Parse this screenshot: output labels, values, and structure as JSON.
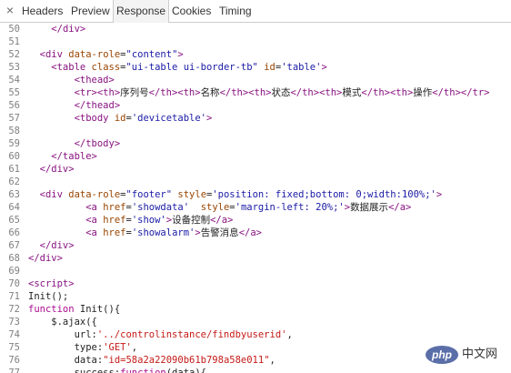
{
  "toolbar": {
    "close_glyph": "×",
    "tabs": [
      {
        "label": "Headers"
      },
      {
        "label": "Preview"
      },
      {
        "label": "Response"
      },
      {
        "label": "Cookies"
      },
      {
        "label": "Timing"
      }
    ],
    "active_tab": "Response"
  },
  "code": {
    "lines": [
      {
        "n": "50",
        "tokens": [
          {
            "t": "    </",
            "c": "tag"
          },
          {
            "t": "div",
            "c": "tag"
          },
          {
            "t": ">",
            "c": "tag"
          }
        ]
      },
      {
        "n": "51",
        "tokens": []
      },
      {
        "n": "52",
        "tokens": [
          {
            "t": "  <div ",
            "c": "tag"
          },
          {
            "t": "data-role",
            "c": "attr"
          },
          {
            "t": "=",
            "c": "plain"
          },
          {
            "t": "\"content\"",
            "c": "val"
          },
          {
            "t": ">",
            "c": "tag"
          }
        ]
      },
      {
        "n": "53",
        "tokens": [
          {
            "t": "    <table ",
            "c": "tag"
          },
          {
            "t": "class",
            "c": "attr"
          },
          {
            "t": "=",
            "c": "plain"
          },
          {
            "t": "\"ui-table ui-border-tb\"",
            "c": "val"
          },
          {
            "t": " ",
            "c": "plain"
          },
          {
            "t": "id",
            "c": "attr"
          },
          {
            "t": "=",
            "c": "plain"
          },
          {
            "t": "'table'",
            "c": "val"
          },
          {
            "t": ">",
            "c": "tag"
          }
        ]
      },
      {
        "n": "54",
        "tokens": [
          {
            "t": "        <thead>",
            "c": "tag"
          }
        ]
      },
      {
        "n": "55",
        "tokens": [
          {
            "t": "        <tr><th>",
            "c": "tag"
          },
          {
            "t": "序列号",
            "c": "plain"
          },
          {
            "t": "</th><th>",
            "c": "tag"
          },
          {
            "t": "名称",
            "c": "plain"
          },
          {
            "t": "</th><th>",
            "c": "tag"
          },
          {
            "t": "状态",
            "c": "plain"
          },
          {
            "t": "</th><th>",
            "c": "tag"
          },
          {
            "t": "模式",
            "c": "plain"
          },
          {
            "t": "</th><th>",
            "c": "tag"
          },
          {
            "t": "操作",
            "c": "plain"
          },
          {
            "t": "</th></tr>",
            "c": "tag"
          }
        ]
      },
      {
        "n": "56",
        "tokens": [
          {
            "t": "        </thead>",
            "c": "tag"
          }
        ]
      },
      {
        "n": "57",
        "tokens": [
          {
            "t": "        <tbody ",
            "c": "tag"
          },
          {
            "t": "id",
            "c": "attr"
          },
          {
            "t": "=",
            "c": "plain"
          },
          {
            "t": "'devicetable'",
            "c": "val"
          },
          {
            "t": ">",
            "c": "tag"
          }
        ]
      },
      {
        "n": "58",
        "tokens": []
      },
      {
        "n": "59",
        "tokens": [
          {
            "t": "        </tbody>",
            "c": "tag"
          }
        ]
      },
      {
        "n": "60",
        "tokens": [
          {
            "t": "    </table>",
            "c": "tag"
          }
        ]
      },
      {
        "n": "61",
        "tokens": [
          {
            "t": "  </div>",
            "c": "tag"
          }
        ]
      },
      {
        "n": "62",
        "tokens": []
      },
      {
        "n": "63",
        "tokens": [
          {
            "t": "  <div ",
            "c": "tag"
          },
          {
            "t": "data-role",
            "c": "attr"
          },
          {
            "t": "=",
            "c": "plain"
          },
          {
            "t": "\"footer\"",
            "c": "val"
          },
          {
            "t": " ",
            "c": "plain"
          },
          {
            "t": "style",
            "c": "attr"
          },
          {
            "t": "=",
            "c": "plain"
          },
          {
            "t": "'position: fixed;bottom: 0;width:100%;'",
            "c": "val"
          },
          {
            "t": ">",
            "c": "tag"
          }
        ]
      },
      {
        "n": "64",
        "tokens": [
          {
            "t": "          <a ",
            "c": "tag"
          },
          {
            "t": "href",
            "c": "attr"
          },
          {
            "t": "=",
            "c": "plain"
          },
          {
            "t": "'showdata'",
            "c": "val"
          },
          {
            "t": "  ",
            "c": "plain"
          },
          {
            "t": "style",
            "c": "attr"
          },
          {
            "t": "=",
            "c": "plain"
          },
          {
            "t": "'margin-left: 20%;'",
            "c": "val"
          },
          {
            "t": ">",
            "c": "tag"
          },
          {
            "t": "数据展示",
            "c": "plain"
          },
          {
            "t": "</a>",
            "c": "tag"
          }
        ]
      },
      {
        "n": "65",
        "tokens": [
          {
            "t": "          <a ",
            "c": "tag"
          },
          {
            "t": "href",
            "c": "attr"
          },
          {
            "t": "=",
            "c": "plain"
          },
          {
            "t": "'show'",
            "c": "val"
          },
          {
            "t": ">",
            "c": "tag"
          },
          {
            "t": "设备控制",
            "c": "plain"
          },
          {
            "t": "</a>",
            "c": "tag"
          }
        ]
      },
      {
        "n": "66",
        "tokens": [
          {
            "t": "          <a ",
            "c": "tag"
          },
          {
            "t": "href",
            "c": "attr"
          },
          {
            "t": "=",
            "c": "plain"
          },
          {
            "t": "'showalarm'",
            "c": "val"
          },
          {
            "t": ">",
            "c": "tag"
          },
          {
            "t": "告警消息",
            "c": "plain"
          },
          {
            "t": "</a>",
            "c": "tag"
          }
        ]
      },
      {
        "n": "67",
        "tokens": [
          {
            "t": "  </div>",
            "c": "tag"
          }
        ]
      },
      {
        "n": "68",
        "tokens": [
          {
            "t": "</div>",
            "c": "tag"
          }
        ]
      },
      {
        "n": "69",
        "tokens": []
      },
      {
        "n": "70",
        "tokens": [
          {
            "t": "<script>",
            "c": "tag"
          }
        ]
      },
      {
        "n": "71",
        "tokens": [
          {
            "t": "Init();",
            "c": "plain"
          }
        ]
      },
      {
        "n": "72",
        "tokens": [
          {
            "t": "function",
            "c": "kw"
          },
          {
            "t": " Init(){",
            "c": "plain"
          }
        ]
      },
      {
        "n": "73",
        "tokens": [
          {
            "t": "    $.ajax({",
            "c": "plain"
          }
        ]
      },
      {
        "n": "74",
        "tokens": [
          {
            "t": "        url:",
            "c": "plain"
          },
          {
            "t": "'../controlinstance/findbyuserid'",
            "c": "str"
          },
          {
            "t": ",",
            "c": "plain"
          }
        ]
      },
      {
        "n": "75",
        "tokens": [
          {
            "t": "        type:",
            "c": "plain"
          },
          {
            "t": "'GET'",
            "c": "str"
          },
          {
            "t": ",",
            "c": "plain"
          }
        ]
      },
      {
        "n": "76",
        "tokens": [
          {
            "t": "        data:",
            "c": "plain"
          },
          {
            "t": "\"id=58a2a22090b61b798a58e011\"",
            "c": "str"
          },
          {
            "t": ",",
            "c": "plain"
          }
        ]
      },
      {
        "n": "77",
        "tokens": [
          {
            "t": "        success:",
            "c": "plain"
          },
          {
            "t": "function",
            "c": "kw"
          },
          {
            "t": "(data){",
            "c": "plain"
          }
        ]
      }
    ]
  },
  "watermark": {
    "logo": "php",
    "text": "中文网"
  }
}
